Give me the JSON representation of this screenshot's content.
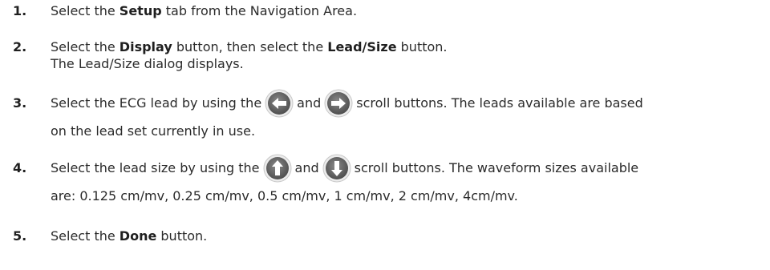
{
  "steps": [
    {
      "number": "1.",
      "pre": "Select the ",
      "bold": "Setup",
      "post": " tab from the Navigation Area."
    },
    {
      "number": "2.",
      "pre": "Select the ",
      "bold1": "Display",
      "mid": " button, then select the ",
      "bold2": "Lead/Size",
      "post": " button.",
      "line2": "The Lead/Size dialog displays."
    },
    {
      "number": "3.",
      "pre": "Select the ECG lead by using the",
      "and": "and",
      "post": "scroll buttons. The leads available are based",
      "line2": "on the lead set currently in use.",
      "icons": [
        "left-arrow-icon",
        "right-arrow-icon"
      ]
    },
    {
      "number": "4.",
      "pre": "Select the lead size by using the",
      "and": "and",
      "post": "scroll buttons. The waveform sizes available",
      "line2": "are: 0.125 cm/mv, 0.25 cm/mv, 0.5 cm/mv, 1 cm/mv, 2 cm/mv, 4cm/mv.",
      "icons": [
        "up-arrow-icon",
        "down-arrow-icon"
      ]
    },
    {
      "number": "5.",
      "pre": "Select the ",
      "bold": "Done",
      "post": " button."
    }
  ],
  "colors": {
    "text": "#2b2b2b",
    "button_fill": "#6b6b6b",
    "button_ring": "#d4d4d4"
  }
}
